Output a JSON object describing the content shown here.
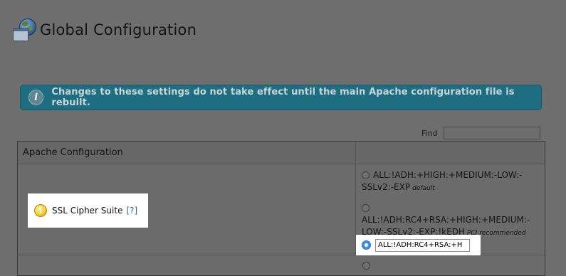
{
  "header": {
    "title": "Global Configuration",
    "icon": "globe-window-icon"
  },
  "notice": {
    "icon": "info-icon",
    "icon_glyph": "i",
    "text": "Changes to these settings do not take effect until the main Apache configuration file is rebuilt."
  },
  "find": {
    "label": "Find",
    "value": ""
  },
  "panel": {
    "heading": "Apache Configuration",
    "setting": {
      "label": "SSL Cipher Suite",
      "help": "[?]",
      "warning_icon": "warning-icon",
      "warning_glyph": "!"
    },
    "options": [
      {
        "line1": "ALL:!ADH:+HIGH:+MEDIUM:-LOW:-",
        "line2": "SSLv2:-EXP",
        "note": "default",
        "selected": false
      },
      {
        "line1": "ALL:!ADH:RC4+RSA:+HIGH:+MEDIUM:-",
        "line2": "LOW:-SSLv2:-EXP:!kEDH",
        "note": "PCI recommended",
        "selected": false
      }
    ],
    "custom": {
      "value": "ALL:!ADH:RC4+RSA:+H",
      "selected": true
    }
  },
  "colors": {
    "notice_bg": "#1f6d80",
    "link": "#2f60b0",
    "radio_selected": "#3e8fe0",
    "warning": "#f3cd3a"
  }
}
